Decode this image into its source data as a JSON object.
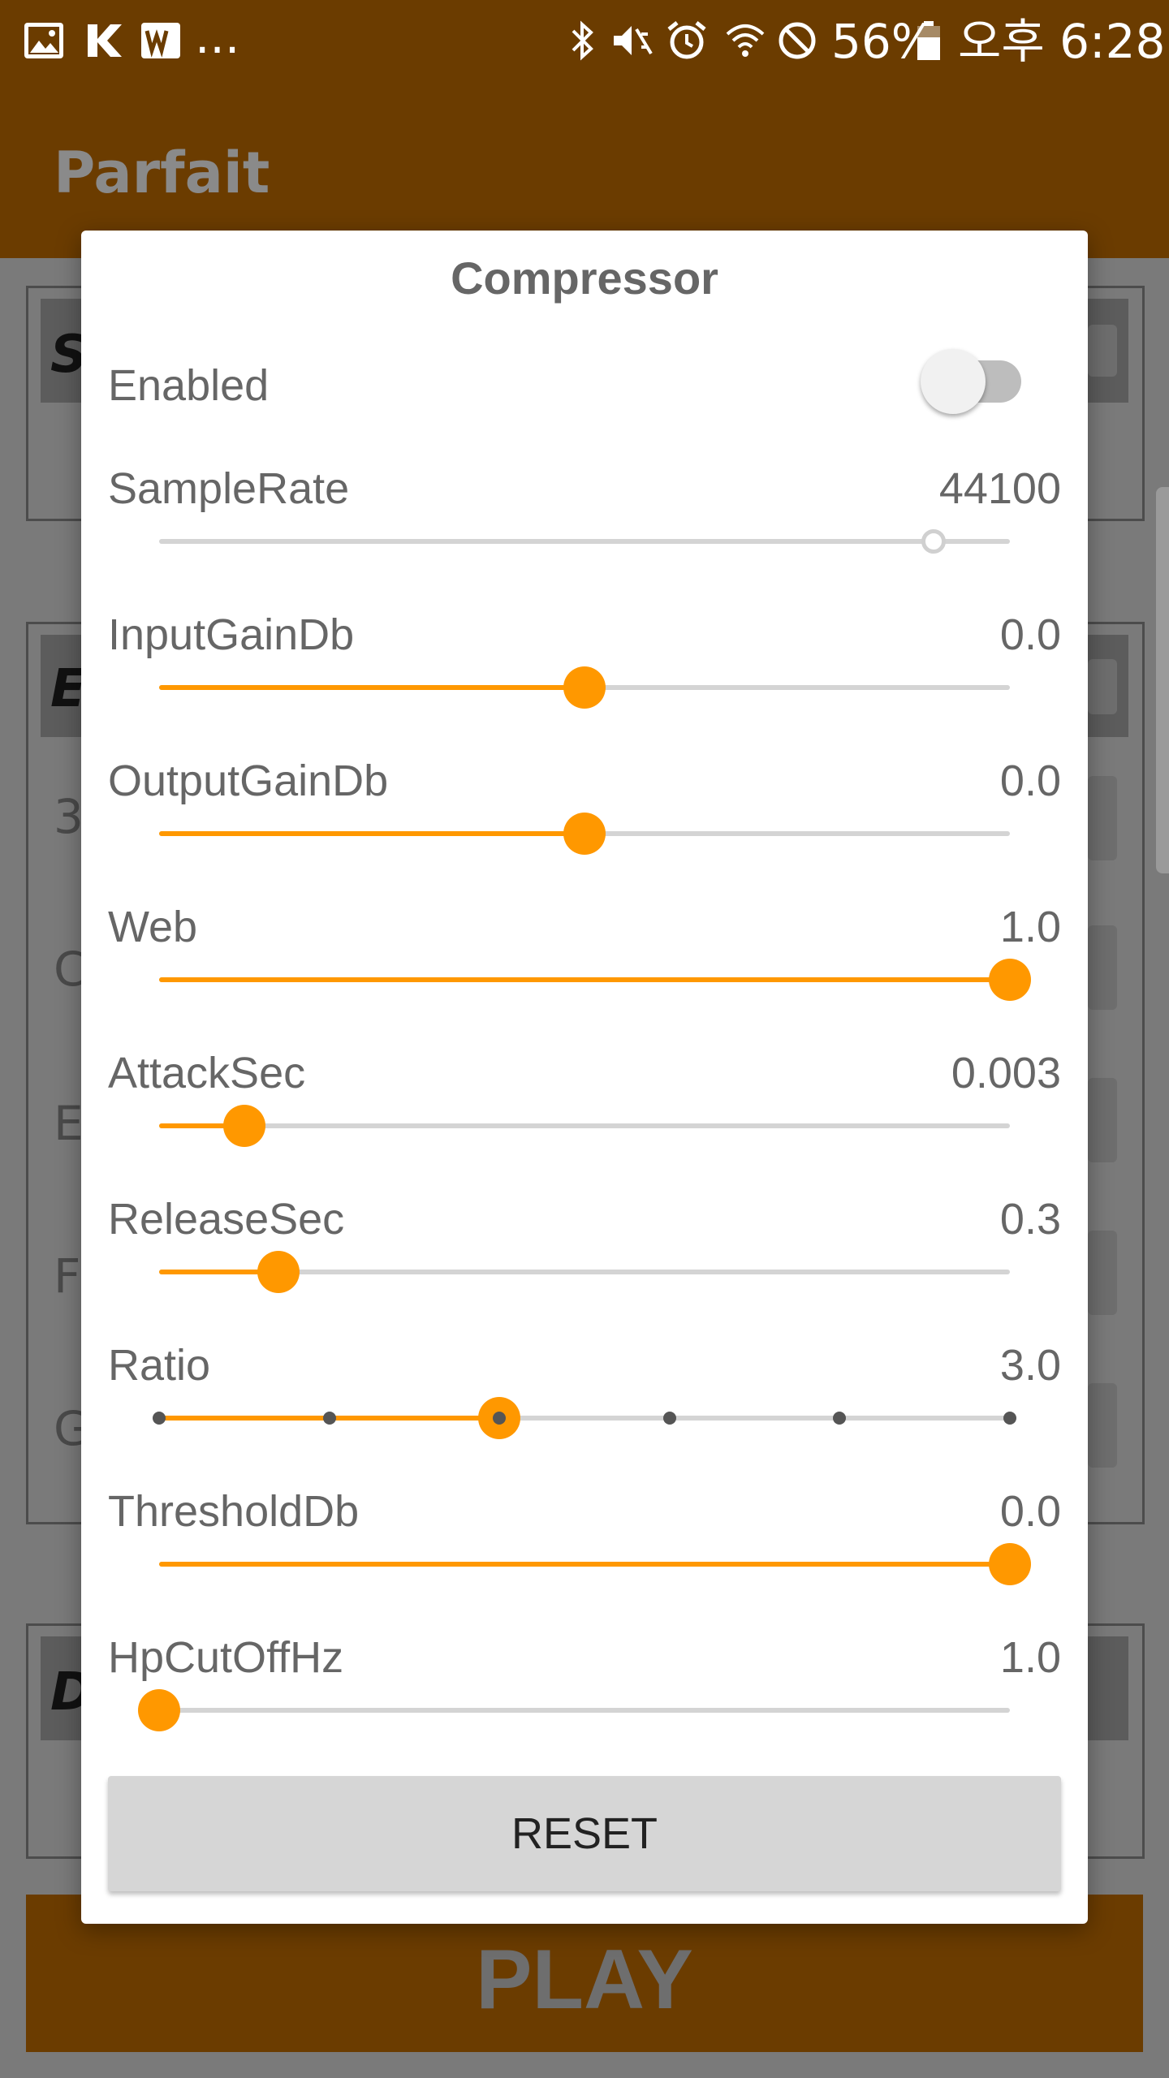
{
  "status_bar": {
    "left_icons": [
      "image-icon",
      "k-app-icon",
      "w-app-icon"
    ],
    "overflow": "...",
    "right_icons": [
      "bluetooth-icon",
      "vibrate-mute-icon",
      "alarm-icon",
      "wifi-icon",
      "do-not-disturb-icon"
    ],
    "battery_percent": "56%",
    "time": "오후 6:28"
  },
  "app": {
    "title": "Parfait",
    "play_label": "PLAY",
    "bg_letters": [
      "S",
      "E",
      "3",
      "C",
      "E",
      "F",
      "G",
      "D"
    ]
  },
  "dialog": {
    "title": "Compressor",
    "enabled_label": "Enabled",
    "enabled": false,
    "reset_label": "RESET",
    "accent_color": "#ff9800",
    "sliders": [
      {
        "label": "SampleRate",
        "value": "44100",
        "fraction": 0.91,
        "disabled": true
      },
      {
        "label": "InputGainDb",
        "value": "0.0",
        "fraction": 0.5
      },
      {
        "label": "OutputGainDb",
        "value": "0.0",
        "fraction": 0.5
      },
      {
        "label": "Web",
        "value": "1.0",
        "fraction": 1.0
      },
      {
        "label": "AttackSec",
        "value": "0.003",
        "fraction": 0.1
      },
      {
        "label": "ReleaseSec",
        "value": "0.3",
        "fraction": 0.14
      },
      {
        "label": "Ratio",
        "value": "3.0",
        "fraction": 0.4,
        "steps": 6
      },
      {
        "label": "ThresholdDb",
        "value": "0.0",
        "fraction": 1.0
      },
      {
        "label": "HpCutOffHz",
        "value": "1.0",
        "fraction": 0.0
      }
    ]
  }
}
